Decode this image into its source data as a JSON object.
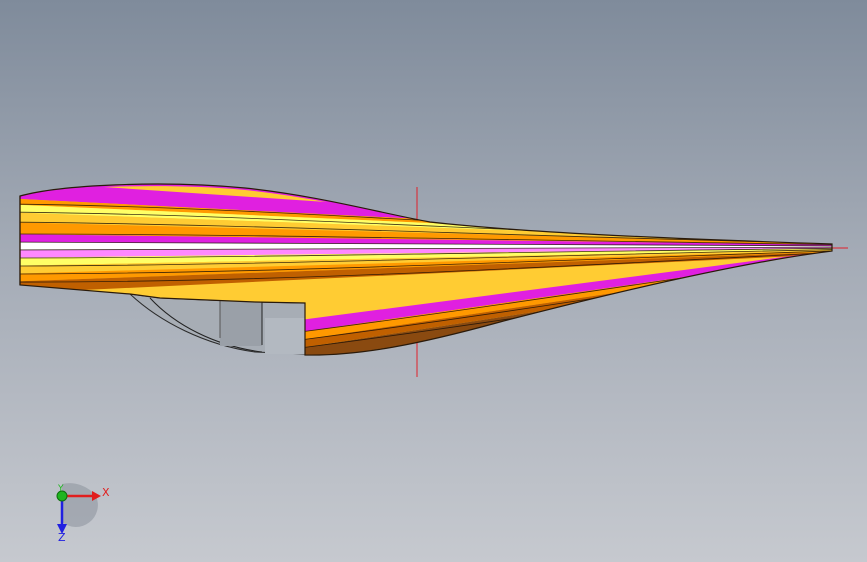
{
  "viewport": {
    "background": [
      "#7f8b9b",
      "#c6c9cf"
    ]
  },
  "model": {
    "type": "tapered laminated wing blade",
    "ply_colors": [
      "#ffcc33",
      "#ff9900",
      "#ffff66",
      "#e020e0",
      "#ff88ff",
      "#ffffff",
      "#c06000",
      "#8a4a10"
    ],
    "outline_color": "#2a1a0a",
    "section_color": "#a7adb5",
    "reference_axis_color": "#e0202a"
  },
  "triad": {
    "x_label": "X",
    "y_label": "Y",
    "z_label": "Z",
    "x_color": "#e11e1e",
    "y_color": "#1fb51f",
    "z_color": "#2020e0",
    "icons": [
      "x-arrow-icon",
      "y-dot-icon",
      "z-arrow-icon"
    ]
  }
}
